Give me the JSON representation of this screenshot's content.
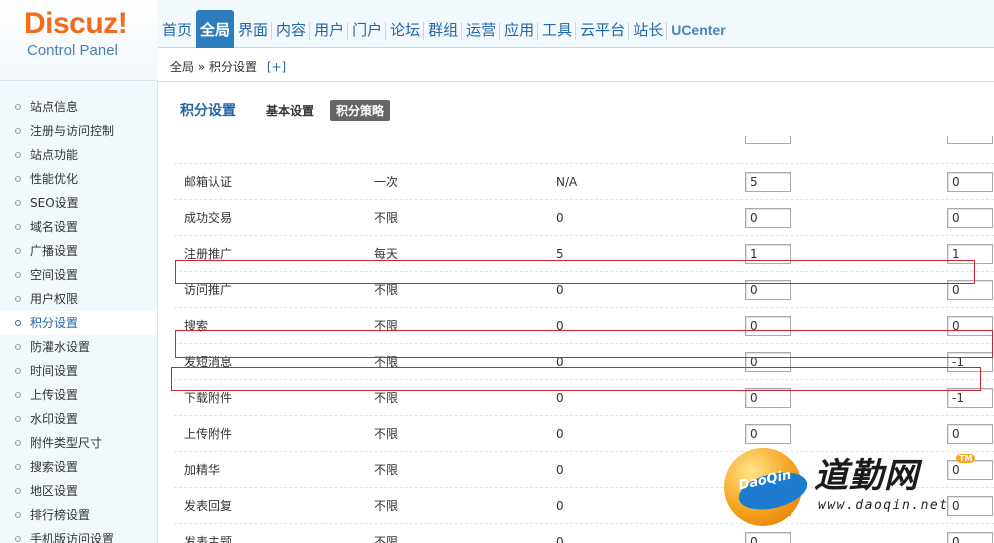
{
  "logo": {
    "main": "Discuz!",
    "sub": "Control Panel"
  },
  "nav": [
    "首页",
    "全局",
    "界面",
    "内容",
    "用户",
    "门户",
    "论坛",
    "群组",
    "运营",
    "应用",
    "工具",
    "云平台",
    "站长",
    "UCenter"
  ],
  "nav_active": "全局",
  "breadcrumb": {
    "text": "全局 » 积分设置",
    "add": "[+]"
  },
  "sidebar": [
    "站点信息",
    "注册与访问控制",
    "站点功能",
    "性能优化",
    "SEO设置",
    "域名设置",
    "广播设置",
    "空间设置",
    "用户权限",
    "积分设置",
    "防灌水设置",
    "时间设置",
    "上传设置",
    "水印设置",
    "附件类型尺寸",
    "搜索设置",
    "地区设置",
    "排行榜设置",
    "手机版访问设置"
  ],
  "sidebar_active": "积分设置",
  "subnav": {
    "title": "积分设置",
    "tabs": [
      "基本设置",
      "积分策略"
    ],
    "active_tab": "积分策略"
  },
  "rows": [
    {
      "name": "邮箱认证",
      "cycle": "一次",
      "reward": "N/A",
      "v1": "5",
      "v2": "0"
    },
    {
      "name": "成功交易",
      "cycle": "不限",
      "reward": "0",
      "v1": "0",
      "v2": "0"
    },
    {
      "name": "注册推广",
      "cycle": "每天",
      "reward": "5",
      "v1": "1",
      "v2": "1"
    },
    {
      "name": "访问推广",
      "cycle": "不限",
      "reward": "0",
      "v1": "0",
      "v2": "0"
    },
    {
      "name": "搜索",
      "cycle": "不限",
      "reward": "0",
      "v1": "0",
      "v2": "0"
    },
    {
      "name": "发短消息",
      "cycle": "不限",
      "reward": "0",
      "v1": "0",
      "v2": "-1"
    },
    {
      "name": "下载附件",
      "cycle": "不限",
      "reward": "0",
      "v1": "0",
      "v2": "-1"
    },
    {
      "name": "上传附件",
      "cycle": "不限",
      "reward": "0",
      "v1": "0",
      "v2": "0"
    },
    {
      "name": "加精华",
      "cycle": "不限",
      "reward": "0",
      "v1": "5",
      "v2": "0"
    },
    {
      "name": "发表回复",
      "cycle": "不限",
      "reward": "0",
      "v1": "0",
      "v2": "0"
    },
    {
      "name": "发表主题",
      "cycle": "不限",
      "reward": "0",
      "v1": "0",
      "v2": "0"
    }
  ],
  "watermark": {
    "badge": "DaoQin",
    "cn": "道勤网",
    "tm": "TM",
    "url": "www.daoqin.net"
  }
}
